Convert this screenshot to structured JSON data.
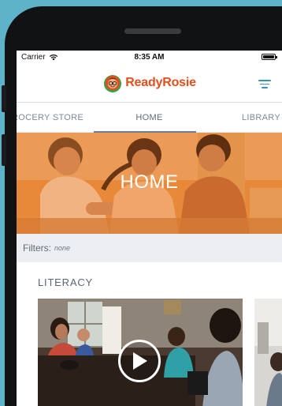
{
  "status_bar": {
    "carrier": "Carrier",
    "time": "8:35 AM"
  },
  "header": {
    "logo_part1": "Ready",
    "logo_part2": "Rosie",
    "brand_color": "#e84e1b",
    "menu_icon": "filter-menu-icon"
  },
  "tabs": {
    "items": [
      {
        "label": "ROCERY STORE"
      },
      {
        "label": "HOME"
      },
      {
        "label": "LIBRARY"
      }
    ],
    "selected": "HOME"
  },
  "hero": {
    "title": "HOME",
    "overlay_color": "#e8893a"
  },
  "filters": {
    "label": "Filters:",
    "value": "none"
  },
  "section": {
    "title": "LITERACY",
    "play_icon": "play-icon"
  }
}
